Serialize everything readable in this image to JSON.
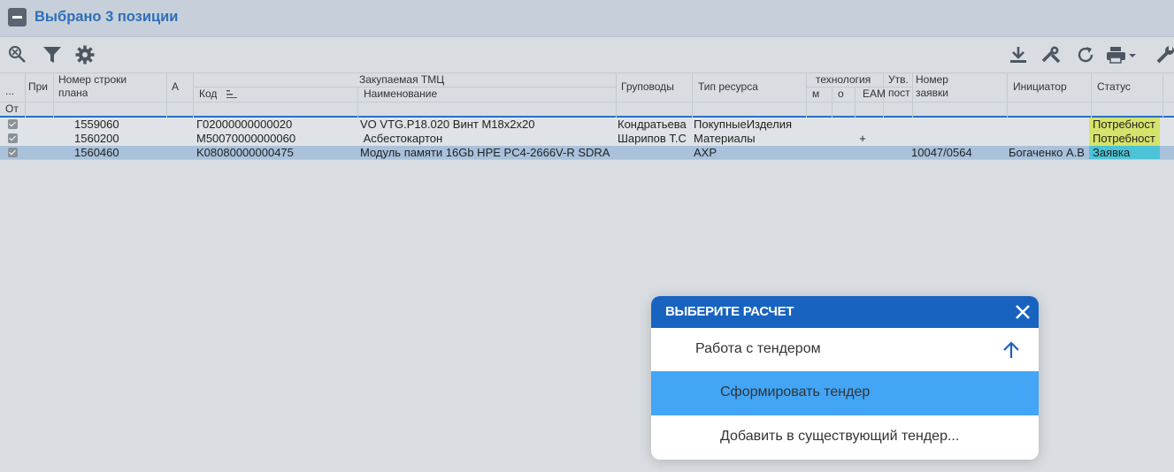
{
  "header": {
    "title": "Выбрано 3 позиции"
  },
  "toolbar": {
    "left_icons": [
      "zoom-out-icon",
      "filter-icon",
      "gear-icon"
    ],
    "right_icons": [
      "download-icon",
      "tools-icon",
      "refresh-icon",
      "print-icon",
      "wrench-icon"
    ]
  },
  "grid": {
    "headers": {
      "sel": "...",
      "sel_sub": "От",
      "col_pri": "При",
      "col_line": "Номер строки",
      "col_line2": "плана",
      "col_a": "А",
      "col_tmc": "Закупаемая ТМЦ",
      "col_code": "Код",
      "col_name": "Наименование",
      "col_group": "Груповоды",
      "col_type": "Тип ресурса",
      "col_tech": "технология",
      "col_tech_m": "м",
      "col_tech_o": "о",
      "col_tech_eam": "EAM",
      "col_appr": "Утв.",
      "col_appr2": "пост",
      "col_req": "Номер",
      "col_req2": "заявки",
      "col_init": "Инициатор",
      "col_status": "Статус"
    },
    "rows": [
      {
        "line": "1559060",
        "code": "Г02000000000020",
        "name": "VO VTG.P18.020 Винт M18x2x20",
        "group": "Кондратьева",
        "type": "ПокупныеИзделия",
        "eam": "",
        "req": "",
        "init": "",
        "status": "Потребност"
      },
      {
        "line": "1560200",
        "code": "M50070000000060",
        "name": " Асбестокартон",
        "group": "Шарипов Т.С",
        "type": "Материалы",
        "eam": "+",
        "req": "",
        "init": "",
        "status": "Потребност"
      },
      {
        "line": "1560460",
        "code": "K08080000000475",
        "name": "Модуль памяти 16Gb HPE PC4-2666V-R SDRA",
        "group": "",
        "type": "АХР",
        "eam": "",
        "req": "10047/0564",
        "init": "Богаченко А.В",
        "status": "Заявка"
      }
    ]
  },
  "modal": {
    "title": "ВЫБЕРИТЕ РАСЧЕТ",
    "group_label": "Работа с тендером",
    "items": [
      "Сформировать тендер",
      "Добавить в существующий тендер..."
    ]
  },
  "colors": {
    "accent": "#1863c0",
    "selected": "#42a5f5",
    "status_need": "#d6e36a",
    "status_req": "#4cc3d6"
  }
}
